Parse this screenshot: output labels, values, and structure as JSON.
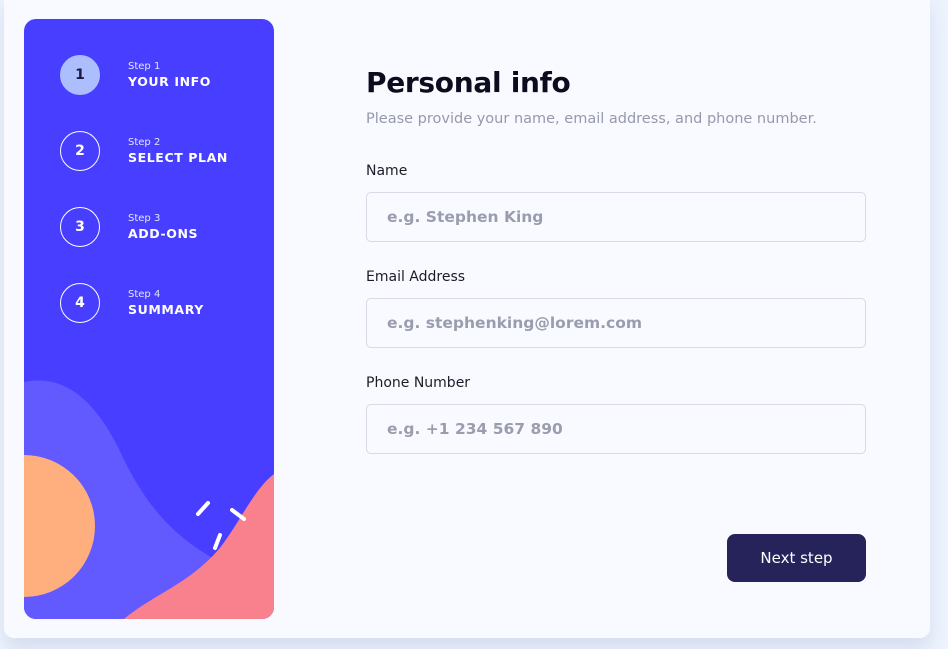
{
  "sidebar": {
    "steps": [
      {
        "number": "1",
        "label": "Step 1",
        "title": "YOUR INFO",
        "active": true
      },
      {
        "number": "2",
        "label": "Step 2",
        "title": "SELECT PLAN",
        "active": false
      },
      {
        "number": "3",
        "label": "Step 3",
        "title": "ADD-ONS",
        "active": false
      },
      {
        "number": "4",
        "label": "Step 4",
        "title": "SUMMARY",
        "active": false
      }
    ],
    "colors": {
      "background": "#483eff",
      "blob": "#6259ff",
      "orange": "#ffaf7e",
      "pink": "#f9818e"
    }
  },
  "form": {
    "title": "Personal info",
    "subtitle": "Please provide your name, email address, and phone number.",
    "fields": [
      {
        "label": "Name",
        "placeholder": "e.g. Stephen King",
        "value": ""
      },
      {
        "label": "Email Address",
        "placeholder": "e.g. stephenking@lorem.com",
        "value": ""
      },
      {
        "label": "Phone Number",
        "placeholder": "e.g. +1 234 567 890",
        "value": ""
      }
    ],
    "next_label": "Next step"
  }
}
